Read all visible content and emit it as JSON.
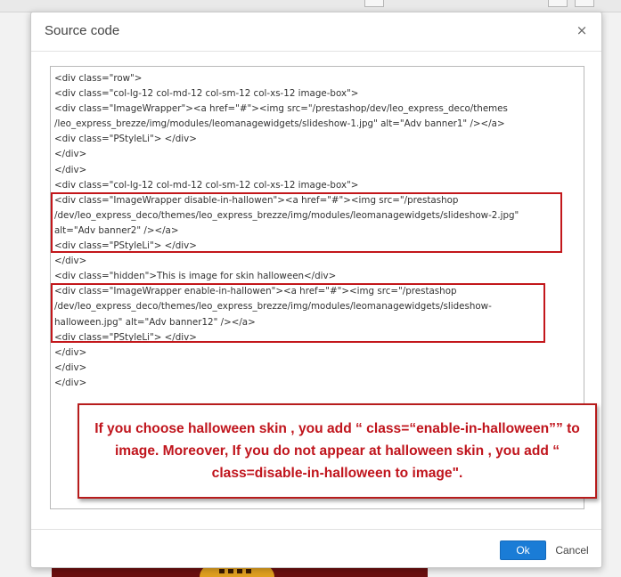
{
  "dialog": {
    "title": "Source code",
    "close_glyph": "×",
    "close_icon": "close-icon"
  },
  "code": {
    "lines": [
      "<div class=\"row\">",
      "<div class=\"col-lg-12 col-md-12 col-sm-12 col-xs-12 image-box\">",
      "<div class=\"ImageWrapper\"><a href=\"#\"><img src=\"/prestashop/dev/leo_express_deco/themes",
      "/leo_express_brezze/img/modules/leomanagewidgets/slideshow-1.jpg\" alt=\"Adv banner1\" /></a>",
      "<div class=\"PStyleLi\"> </div>",
      "</div>",
      "</div>",
      "<div class=\"col-lg-12 col-md-12 col-sm-12 col-xs-12 image-box\">",
      "<div class=\"ImageWrapper disable-in-hallowen\"><a href=\"#\"><img src=\"/prestashop",
      "/dev/leo_express_deco/themes/leo_express_brezze/img/modules/leomanagewidgets/slideshow-2.jpg\"",
      "alt=\"Adv banner2\" /></a>",
      "<div class=\"PStyleLi\"> </div>",
      "</div>",
      "<div class=\"hidden\">This is image for skin halloween</div>",
      "<div class=\"ImageWrapper enable-in-hallowen\"><a href=\"#\"><img src=\"/prestashop",
      "/dev/leo_express_deco/themes/leo_express_brezze/img/modules/leomanagewidgets/slideshow-",
      "halloween.jpg\" alt=\"Adv banner12\" /></a>",
      "<div class=\"PStyleLi\"> </div>",
      "</div>",
      "</div>",
      "</div>"
    ]
  },
  "callout": {
    "text": "If you choose halloween skin , you add “ class=“enable-in-halloween”” to image. Moreover, If you do not appear at halloween skin , you add “ class=disable-in-halloween to image\"."
  },
  "footer": {
    "ok_label": "Ok",
    "cancel_label": "Cancel"
  },
  "colors": {
    "primary_button": "#1a7cd6",
    "highlight_border": "#c3171b",
    "callout_text": "#c0141c"
  }
}
